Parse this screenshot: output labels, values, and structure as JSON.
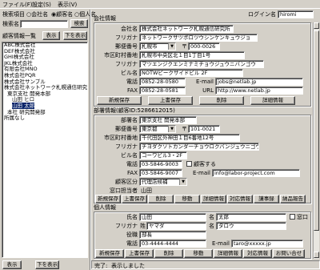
{
  "menu": [
    "ファイル(F)",
    "設定(S)",
    "表示(V)"
  ],
  "search": {
    "category_label": "検索項目",
    "filter1": "会社名",
    "filter2": "顧客名",
    "filter3": "個人名",
    "keyword_label": "検索名",
    "search_button": "検索"
  },
  "list_panel": {
    "title": "顧客情報一覧",
    "show_button": "表示",
    "bottom_button": "下を表示",
    "tree": [
      {
        "label": "ABC株式会社",
        "selected": false
      },
      {
        "label": "DEF株式会社",
        "selected": false
      },
      {
        "label": "GHI株式会社",
        "selected": false
      },
      {
        "label": "JKL株式会社",
        "selected": false
      },
      {
        "label": "有限会社MNO",
        "selected": false
      },
      {
        "label": "株式会社PQR",
        "selected": false
      },
      {
        "label": "株式会社サンプル",
        "selected": false
      },
      {
        "label": "株式会社ネットワーク札幌通信研究所",
        "selected": false
      },
      {
        "label": "東京支社 開発本部",
        "selected": false
      },
      {
        "label": "山田 ヒロ",
        "selected": false
      },
      {
        "label": "山田 太郎",
        "selected": true
      },
      {
        "label": "本社 研究開発部",
        "selected": false
      },
      {
        "label": "所属なし",
        "selected": false
      }
    ],
    "footer_show": "表示",
    "footer_bottom": "下を表示"
  },
  "login": {
    "label": "ログイン名",
    "value": "hiromi"
  },
  "company": {
    "section_label": "会社情報",
    "name_label": "会社名",
    "name": "株式会社ネットワーク札幌通信研究所",
    "kana_label": "フリガナ",
    "kana": "ネットワークサツポロツウシンケンキュウジョ",
    "postal_label": "郵便番号",
    "prefecture": "札幌市",
    "postal": "000-0026",
    "address_label": "市区町村番地",
    "address": "札幌市中央区北１目1丁目1号",
    "address_kana_label": "フリガナ",
    "address_kana": "マツエンジクエンミナミチョウジュウニバンゴウ",
    "building_label": "ビル名",
    "building": "NOTWビークサイドビル 2F",
    "tel_label": "電話",
    "tel": "0852-28-0580",
    "email_label": "E-mail",
    "email": "jobs@netlab.jp",
    "fax_label": "FAX",
    "fax": "0852-28-0581",
    "url_label": "URL",
    "url": "http://www.netlab.jp",
    "buttons": [
      "新規保存",
      "上書保存",
      "削除",
      "詳細情報"
    ]
  },
  "department": {
    "section_label": "部署情報(顧客ID:5286612015)",
    "name_label": "部署名",
    "name": "東京支社 開発本部",
    "postal_label": "郵便番号",
    "prefecture": "東京都",
    "postal": "101-0021",
    "address_label": "市区町村番地",
    "address": "千代田区外神田１目6番地12号",
    "address_kana_label": "フリガナ",
    "address_kana": "チヨダクソトカンダ一チョウロクバンジュウニゴウ",
    "building_label": "ビル名",
    "building": "コーワビル3・2F",
    "tel_label": "電話",
    "tel": "03-5846-9003",
    "check_label": "顧客する",
    "fax_label": "FAX",
    "fax": "03-5846-9007",
    "email_label": "E-mail",
    "email": "info@labor-project.com",
    "customer_type_label": "顧客区分",
    "customer_type": "代理店候補",
    "window_label": "窓口担当者",
    "window_value": "山田",
    "buttons": [
      "新規保存",
      "上書保存",
      "削除",
      "移動",
      "詳細情報",
      "対応情報",
      "講事録",
      "納品報告"
    ]
  },
  "person": {
    "section_label": "個人情報",
    "surname_label": "氏名",
    "surname": "山田",
    "given_label": "名",
    "given": "太郎",
    "main_contact_label": "窓口",
    "kana_label": "フリガナ",
    "kana_surname_prefix": "姓",
    "kana_surname": "ヤマダ",
    "kana_given_prefix": "名",
    "kana_given": "タロウ",
    "title_label": "役職",
    "title": "部長",
    "tel_label": "電話",
    "tel": "03-4444-4444",
    "email_label": "E-mail",
    "email": "taro@xxxxx.jp",
    "buttons": [
      "新規保存",
      "上書保存",
      "削除",
      "移動",
      "詳細情報",
      "対応情報",
      "お問い合せ"
    ]
  },
  "status": {
    "label": "完了:",
    "text": "表示しました"
  }
}
